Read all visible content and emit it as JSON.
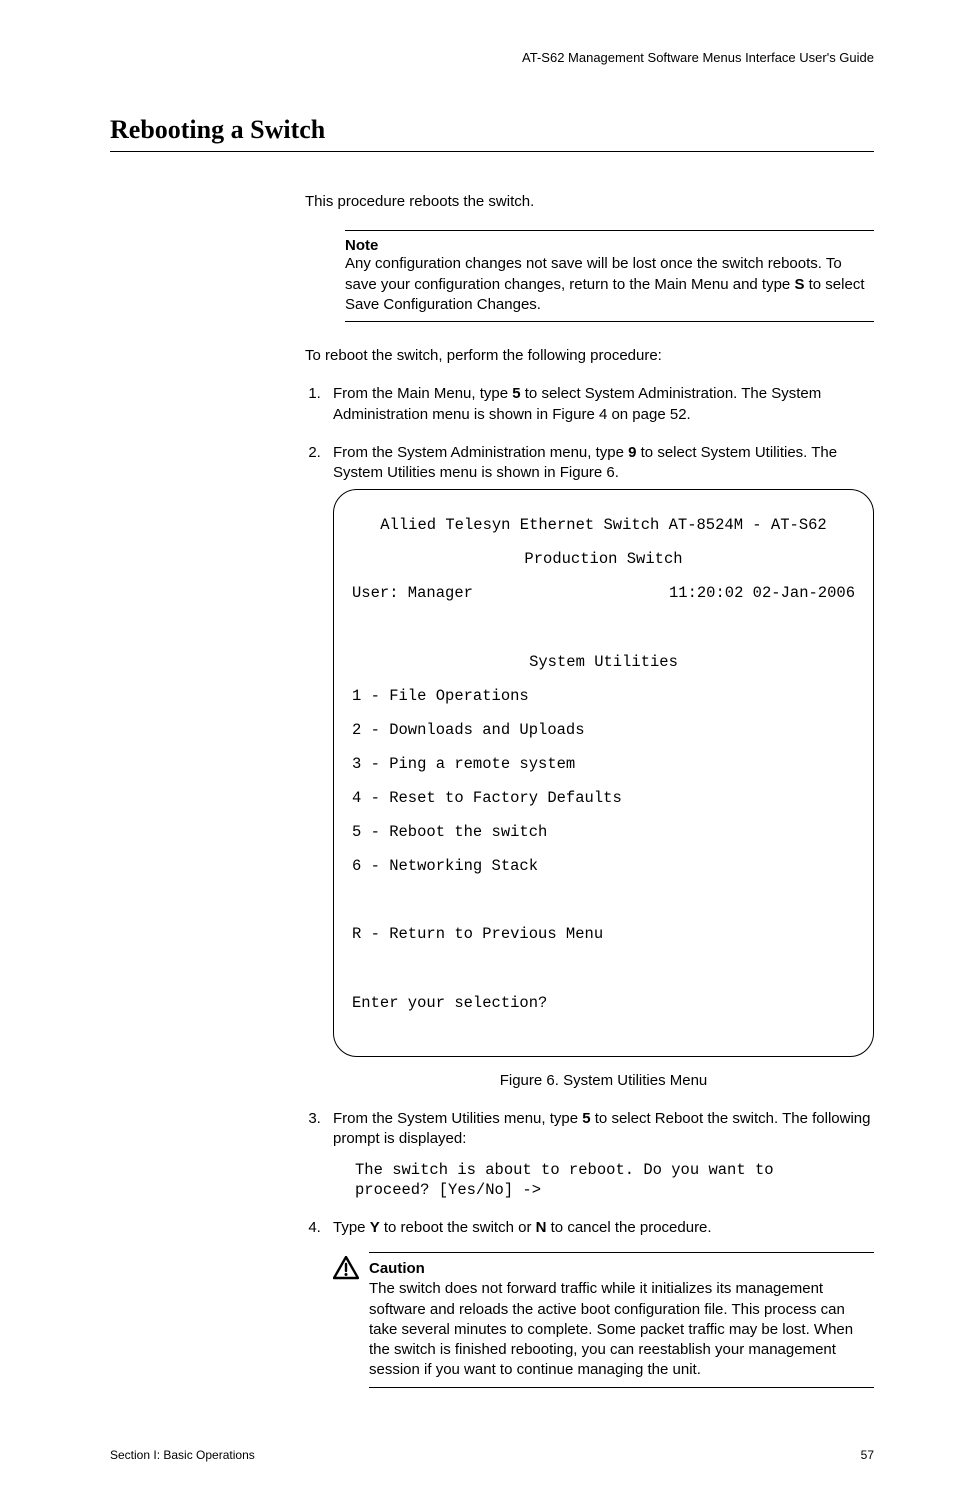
{
  "running_head": "AT-S62 Management Software Menus Interface User's Guide",
  "section_title": "Rebooting a Switch",
  "intro": "This procedure reboots the switch.",
  "note": {
    "title": "Note",
    "body_1": "Any configuration changes not save will be lost once the switch reboots. To save your configuration changes, return to the Main Menu and type ",
    "bold_S": "S",
    "body_2": " to select Save Configuration Changes."
  },
  "lead_in": "To reboot the switch, perform the following procedure:",
  "steps": {
    "s1_a": "From the Main Menu, type ",
    "s1_b5": "5",
    "s1_c": " to select System Administration. The System Administration menu is shown in Figure 4 on page 52.",
    "s2_a": "From the System Administration menu, type ",
    "s2_b9": "9",
    "s2_c": " to select System Utilities. The System Utilities menu is shown in Figure 6.",
    "s3_a": "From the System Utilities menu, type ",
    "s3_b5": "5",
    "s3_c": " to select Reboot the switch. The following prompt is displayed:",
    "s4_a": "Type ",
    "s4_Y": "Y",
    "s4_b": " to reboot the switch or ",
    "s4_N": "N",
    "s4_c": " to cancel the procedure."
  },
  "terminal": {
    "line1": "Allied Telesyn Ethernet Switch AT-8524M - AT-S62",
    "line2": "Production Switch",
    "user_label": "User: Manager",
    "timestamp": "11:20:02 02-Jan-2006",
    "menu_title": "System Utilities",
    "items": [
      "1 - File Operations",
      "2 - Downloads and Uploads",
      "3 - Ping a remote system",
      "4 - Reset to Factory Defaults",
      "5 - Reboot the switch",
      "6 - Networking Stack"
    ],
    "return_line": "R - Return to Previous Menu",
    "prompt": "Enter your selection?"
  },
  "figure_caption": "Figure 6. System Utilities Menu",
  "reboot_prompt": "The switch is about to reboot. Do you want to\nproceed? [Yes/No] ->",
  "caution": {
    "title": "Caution",
    "body": "The switch does not forward traffic while it initializes its management software and reloads the active boot configuration file. This process can take several minutes to complete. Some packet traffic may be lost. When the switch is finished rebooting, you can reestablish your management session if you want to continue managing the unit."
  },
  "footer": {
    "left": "Section I: Basic Operations",
    "right": "57"
  }
}
